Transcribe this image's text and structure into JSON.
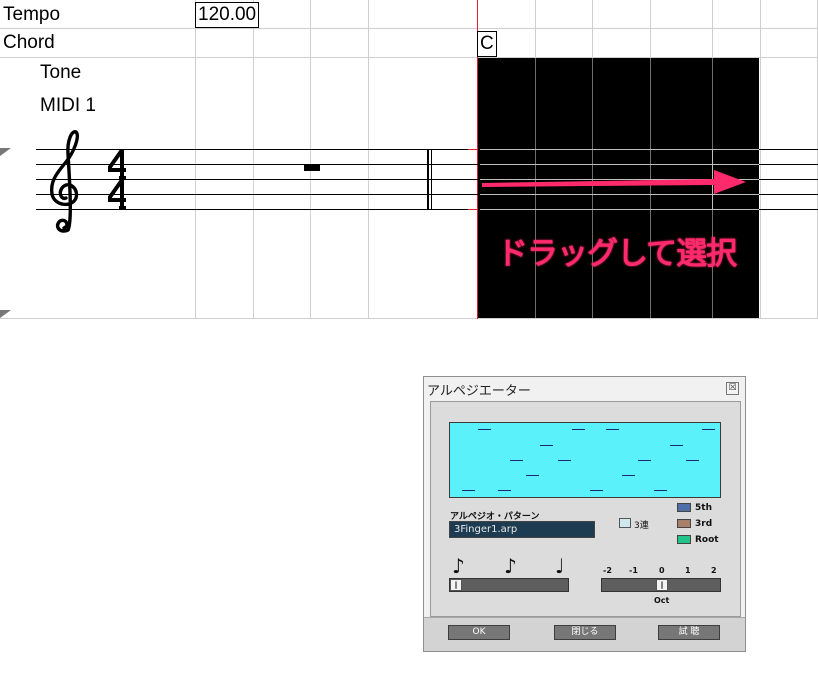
{
  "rows": {
    "tempo_label": "Tempo",
    "tempo_value": "120.00",
    "chord_label": "Chord",
    "chord_value": "C"
  },
  "track": {
    "tone_label": "Tone",
    "midi_label": "MIDI 1"
  },
  "callout_text": "ドラッグして選択",
  "colors": {
    "selection": "#000000",
    "callout": "#ff2a6c",
    "cursor": "#e0202a",
    "pattern_bg": "#5af1fb"
  },
  "icons": {
    "clef": "treble-clef",
    "time_signature": "4/4",
    "rest": "half-rest",
    "arrow": "right-arrow"
  },
  "dialog": {
    "title": "アルペジエーター",
    "close_glyph": "☒",
    "pattern_label": "アルペジオ・パターン",
    "pattern_value": "3Finger1.arp",
    "triplet_label": "3連",
    "legend": [
      {
        "label": "5th",
        "color": "#4f6fa8"
      },
      {
        "label": "3rd",
        "color": "#a8806a"
      },
      {
        "label": "Root",
        "color": "#22c48a"
      }
    ],
    "note_glyphs": [
      "♪",
      "♪",
      "♩"
    ],
    "octave_ticks": [
      "-2",
      "-1",
      "0",
      "1",
      "2"
    ],
    "octave_label": "Oct",
    "thumb_glyph": "‖",
    "buttons": {
      "ok": "OK",
      "close": "閉じる",
      "trial": "試 聴"
    }
  }
}
